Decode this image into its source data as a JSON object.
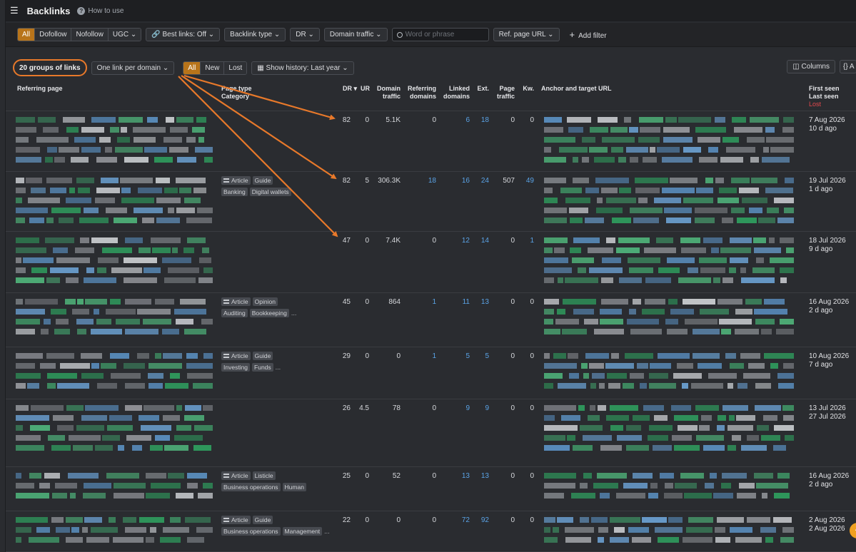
{
  "header": {
    "title": "Backlinks",
    "how_to_use": "How to use"
  },
  "filters": {
    "link_types": [
      "All",
      "Dofollow",
      "Nofollow",
      "UGC"
    ],
    "best_links": "Best links: Off",
    "backlink_type": "Backlink type",
    "dr": "DR",
    "domain_traffic": "Domain traffic",
    "search_placeholder": "Word or phrase",
    "ref_page_url": "Ref. page URL",
    "add_filter": "Add filter"
  },
  "subbar": {
    "groups": "20 groups of links",
    "one_link": "One link per domain",
    "history_tabs": [
      "All",
      "New",
      "Lost"
    ],
    "show_history": "Show history: Last year",
    "columns": "Columns",
    "code_btn": "{} A"
  },
  "columns": {
    "referring_page": "Referring page",
    "page_type": "Page type",
    "category": "Category",
    "dr": "DR",
    "ur": "UR",
    "domain_traffic_1": "Domain",
    "domain_traffic_2": "traffic",
    "referring_domains_1": "Referring",
    "referring_domains_2": "domains",
    "linked_domains_1": "Linked",
    "linked_domains_2": "domains",
    "ext": "Ext.",
    "page_traffic_1": "Page",
    "page_traffic_2": "traffic",
    "kw": "Kw.",
    "anchor": "Anchor and target URL",
    "first_seen": "First seen",
    "last_seen": "Last seen",
    "lost": "Lost"
  },
  "rows": [
    {
      "dr": "82",
      "ur": "0",
      "dtraffic": "5.1K",
      "refdom": "0",
      "linked": "6",
      "ext": "18",
      "ptraffic": "0",
      "kw": "0",
      "first": "7 Aug 2026",
      "last": "10 d ago",
      "tags1": [],
      "tags2": []
    },
    {
      "dr": "82",
      "ur": "5",
      "dtraffic": "306.3K",
      "refdom": "18",
      "linked": "16",
      "ext": "24",
      "ptraffic": "507",
      "kw": "49",
      "first": "19 Jul 2026",
      "last": "1 d ago",
      "tags1": [
        "Article",
        "Guide"
      ],
      "tags2": [
        "Banking",
        "Digital wallets"
      ]
    },
    {
      "dr": "47",
      "ur": "0",
      "dtraffic": "7.4K",
      "refdom": "0",
      "linked": "12",
      "ext": "14",
      "ptraffic": "0",
      "kw": "1",
      "first": "18 Jul 2026",
      "last": "9 d ago",
      "tags1": [],
      "tags2": []
    },
    {
      "dr": "45",
      "ur": "0",
      "dtraffic": "864",
      "refdom": "1",
      "linked": "11",
      "ext": "13",
      "ptraffic": "0",
      "kw": "0",
      "first": "16 Aug 2026",
      "last": "2 d ago",
      "tags1": [
        "Article",
        "Opinion"
      ],
      "tags2": [
        "Auditing",
        "Bookkeeping",
        "..."
      ]
    },
    {
      "dr": "29",
      "ur": "0",
      "dtraffic": "0",
      "refdom": "1",
      "linked": "5",
      "ext": "5",
      "ptraffic": "0",
      "kw": "0",
      "first": "10 Aug 2026",
      "last": "7 d ago",
      "tags1": [
        "Article",
        "Guide"
      ],
      "tags2": [
        "Investing",
        "Funds",
        "..."
      ]
    },
    {
      "dr": "26",
      "ur": "4.5",
      "dtraffic": "78",
      "refdom": "0",
      "linked": "9",
      "ext": "9",
      "ptraffic": "0",
      "kw": "0",
      "first": "13 Jul 2026",
      "last": "27 Jul 2026",
      "tags1": [],
      "tags2": []
    },
    {
      "dr": "25",
      "ur": "0",
      "dtraffic": "52",
      "refdom": "0",
      "linked": "13",
      "ext": "13",
      "ptraffic": "0",
      "kw": "0",
      "first": "16 Aug 2026",
      "last": "2 d ago",
      "tags1": [
        "Article",
        "Listicle"
      ],
      "tags2": [
        "Business operations",
        "Human"
      ]
    },
    {
      "dr": "22",
      "ur": "0",
      "dtraffic": "0",
      "refdom": "0",
      "linked": "72",
      "ext": "92",
      "ptraffic": "0",
      "kw": "0",
      "first": "2 Aug 2026",
      "last": "2 Aug 2026",
      "tags1": [
        "Article",
        "Guide"
      ],
      "tags2": [
        "Business operations",
        "Management",
        "..."
      ]
    }
  ],
  "colors": {
    "accent": "#b8741a",
    "annotation": "#e8792a",
    "link": "#5aa3e6",
    "lost": "#e5484d"
  },
  "icons": {
    "menu": "hamburger-icon",
    "help": "help-icon",
    "search": "search-icon",
    "link": "link-icon",
    "calendar": "calendar-icon",
    "columns": "columns-icon"
  },
  "fab_label": "^"
}
